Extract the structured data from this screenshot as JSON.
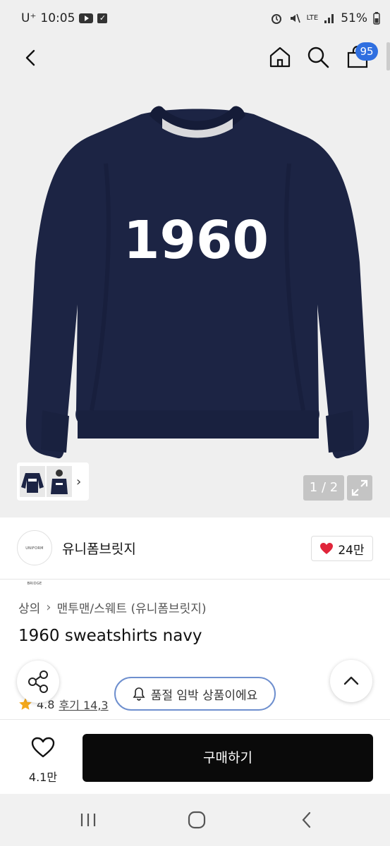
{
  "status_bar": {
    "carrier": "U⁺",
    "time": "10:05",
    "network": "LTE",
    "battery": "51%"
  },
  "header": {
    "cart_count": "95"
  },
  "gallery": {
    "print_text": "1960",
    "counter": "1 / 2"
  },
  "brand": {
    "logo_text": "UNIFORM BRIDGE",
    "name": "유니폼브릿지",
    "likes": "24만"
  },
  "product": {
    "breadcrumb": [
      "상의",
      "맨투맨/스웨트 (유니폼브릿지)"
    ],
    "title": "1960 sweatshirts navy",
    "rating": "4.8",
    "reviews": "후기 14,3"
  },
  "toast": {
    "text": "품절 임박 상품이에요"
  },
  "bottom": {
    "wish_count": "4.1만",
    "buy_label": "구매하기"
  },
  "colors": {
    "accent": "#2f6fe0",
    "sweatshirt": "#1c2444",
    "heart": "#e0253a",
    "star": "#f3a81b"
  }
}
